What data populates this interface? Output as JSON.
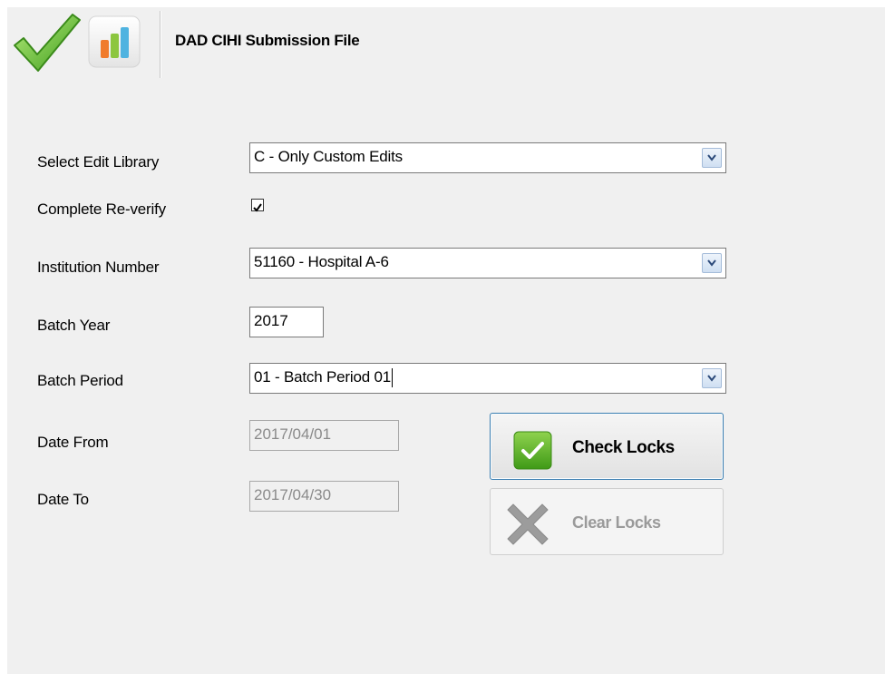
{
  "toolbar": {
    "title": "DAD CIHI Submission File",
    "icons": [
      "checkmark-icon",
      "bar-chart-icon"
    ]
  },
  "form": {
    "edit_library": {
      "label": "Select Edit Library",
      "value": "C - Only Custom Edits"
    },
    "complete_reverify": {
      "label": "Complete Re-verify",
      "checked": true
    },
    "institution": {
      "label": "Institution Number",
      "value": "51160 - Hospital A-6"
    },
    "batch_year": {
      "label": "Batch Year",
      "value": "2017"
    },
    "batch_period": {
      "label": "Batch Period",
      "value": "01 - Batch Period 01"
    },
    "date_from": {
      "label": "Date From",
      "value": "2017/04/01"
    },
    "date_to": {
      "label": "Date To",
      "value": "2017/04/30"
    }
  },
  "actions": {
    "check_locks": "Check Locks",
    "clear_locks": "Clear Locks"
  },
  "colors": {
    "accent_green": "#5fb82a",
    "button_border": "#3c7fb1",
    "disabled_text": "#9a9a9a"
  }
}
